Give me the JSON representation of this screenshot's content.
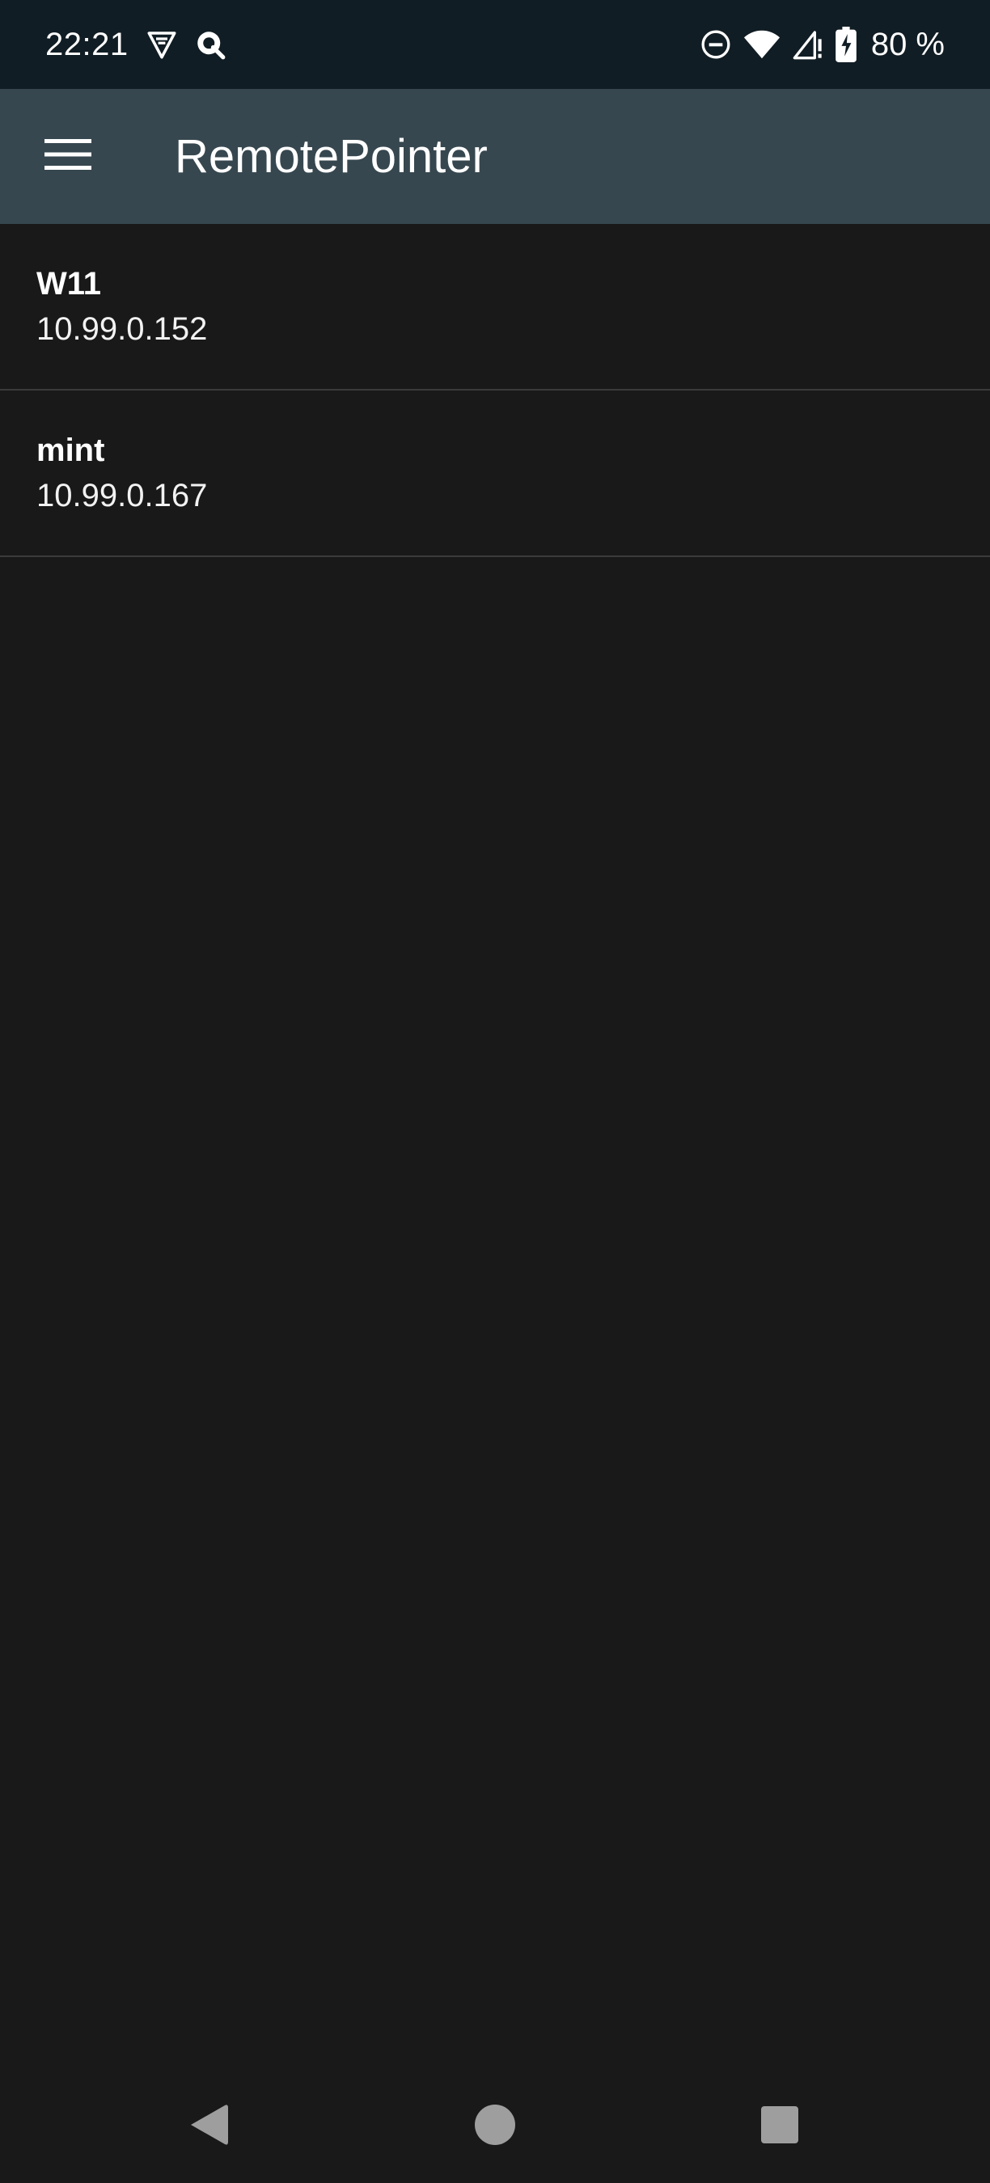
{
  "status_bar": {
    "time": "22:21",
    "battery": "80 %",
    "icons": [
      "vpn-shield-icon",
      "search-app-icon",
      "do-not-disturb-icon",
      "wifi-icon",
      "cellular-signal-icon",
      "battery-charging-icon"
    ]
  },
  "app_bar": {
    "title": "RemotePointer",
    "menu_icon": "hamburger-menu-icon"
  },
  "devices": [
    {
      "name": "W11",
      "ip": "10.99.0.152"
    },
    {
      "name": "mint",
      "ip": "10.99.0.167"
    }
  ],
  "nav_bar": {
    "icons": [
      "back-icon",
      "home-icon",
      "recents-icon"
    ]
  },
  "colors": {
    "status_bar_bg": "#111d24",
    "app_bar_bg": "#37474f",
    "background": "#191919",
    "divider": "#3b3b3b",
    "nav_icon": "#9e9e9e"
  }
}
